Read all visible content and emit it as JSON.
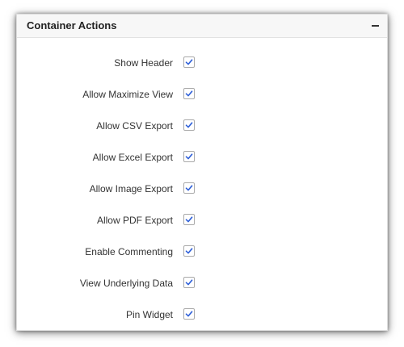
{
  "panel": {
    "title": "Container Actions",
    "collapse_icon": "minus-icon"
  },
  "accent_color": "#2e5fd8",
  "options": [
    {
      "label": "Show Header",
      "checked": true
    },
    {
      "label": "Allow Maximize View",
      "checked": true
    },
    {
      "label": "Allow CSV Export",
      "checked": true
    },
    {
      "label": "Allow Excel Export",
      "checked": true
    },
    {
      "label": "Allow Image Export",
      "checked": true
    },
    {
      "label": "Allow PDF Export",
      "checked": true
    },
    {
      "label": "Enable Commenting",
      "checked": true
    },
    {
      "label": "View Underlying Data",
      "checked": true
    },
    {
      "label": "Pin Widget",
      "checked": true
    }
  ]
}
